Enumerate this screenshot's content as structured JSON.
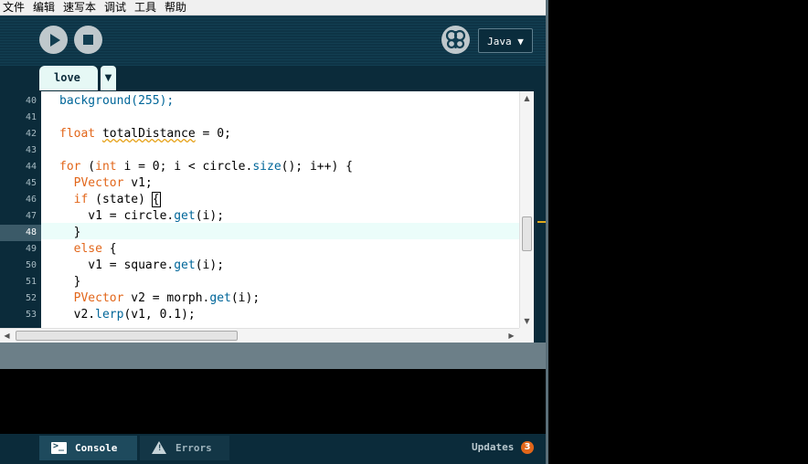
{
  "menu": [
    "文件",
    "编辑",
    "速写本",
    "调试",
    "工具",
    "帮助"
  ],
  "toolbar": {
    "run_icon": "play-icon",
    "stop_icon": "stop-icon",
    "debug_icon": "butterfly-icon",
    "mode_label": "Java ▼"
  },
  "tabs": [
    {
      "label": "love"
    }
  ],
  "tab_menu_glyph": "▼",
  "editor": {
    "current_line": 48,
    "line_numbers": [
      "40",
      "41",
      "42",
      "43",
      "44",
      "45",
      "46",
      "47",
      "48",
      "49",
      "50",
      "51",
      "52",
      "53"
    ]
  },
  "code_lines": [
    "background(255);",
    "",
    "float totalDistance = 0;",
    "",
    "for (int i = 0; i < circle.size(); i++) {",
    "  PVector v1;",
    "  if (state) {",
    "    v1 = circle.get(i);",
    "  }",
    "  else {",
    "    v1 = square.get(i);",
    "  }",
    "  PVector v2 = morph.get(i);",
    "  v2.lerp(v1, 0.1);"
  ],
  "footer": {
    "console_label": "Console",
    "errors_label": "Errors",
    "updates_label": "Updates",
    "updates_count": "3"
  },
  "colors": {
    "background": "#0b2b3a",
    "keyword": "#e2661a",
    "function": "#006699",
    "tab_bg": "#e6f8f5",
    "highlight_line": "#ebfdfa",
    "badge": "#e2661a"
  }
}
